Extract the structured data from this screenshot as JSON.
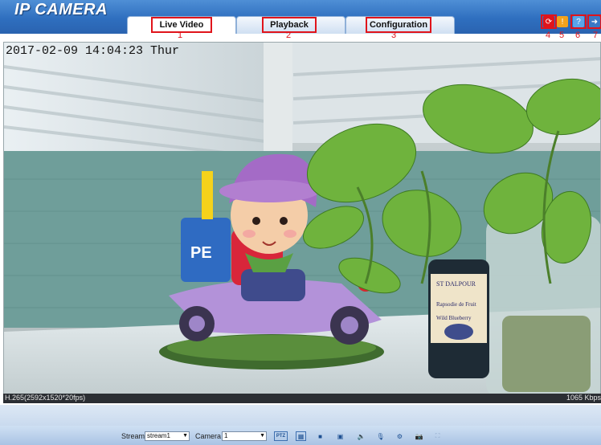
{
  "app": {
    "logo_text": "IP CAMERA"
  },
  "tabs": [
    {
      "label": "Live Video",
      "callout": "1",
      "active": true
    },
    {
      "label": "Playback",
      "callout": "2",
      "active": false
    },
    {
      "label": "Configuration",
      "callout": "3",
      "active": false
    }
  ],
  "header_icons": [
    {
      "name": "refresh-icon",
      "callout": "4"
    },
    {
      "name": "user-icon",
      "callout": "5"
    },
    {
      "name": "help-icon",
      "callout": "6"
    },
    {
      "name": "logout-icon",
      "callout": "7"
    }
  ],
  "video": {
    "timestamp": "2017-02-09 14:04:23 Thur",
    "codec_info": "H.265(2592x1520*20fps)",
    "bitrate": "1065 Kbps"
  },
  "controls": {
    "stream_label": "Stream",
    "stream_value": "stream1",
    "camera_label": "Camera",
    "camera_value": "1",
    "ptz_label": "PTZ"
  },
  "colors": {
    "header_blue": "#2f6fbf",
    "callout_red": "#e0141b"
  }
}
